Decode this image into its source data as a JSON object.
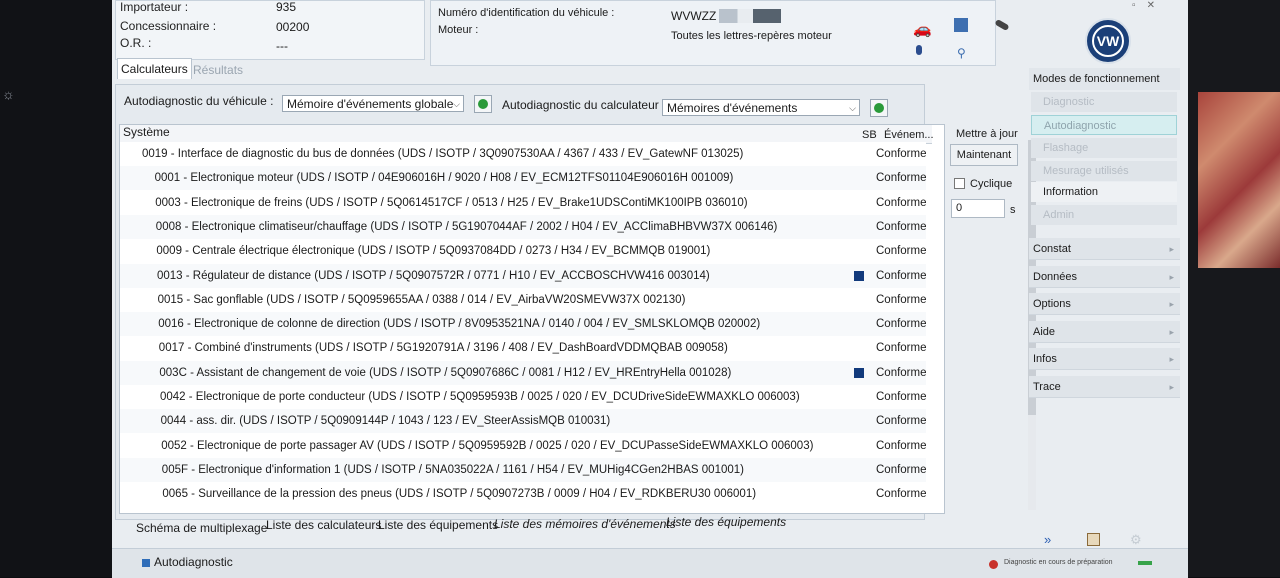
{
  "header": {
    "importer_label": "Importateur :",
    "importer_value": "935",
    "dealer_label": "Concessionnaire :",
    "dealer_value": "00200",
    "or_label": "O.R. :",
    "or_value": "---",
    "vin_label": "Numéro d'identification du véhicule :",
    "vin_value": "WVWZZ",
    "engine_label": "Moteur :",
    "engine_value": "Toutes les lettres-repères moteur"
  },
  "tabs": [
    {
      "label": "Calculateurs"
    },
    {
      "label": "Résultats"
    }
  ],
  "toolbar": {
    "vehicle_diag_label": "Autodiagnostic du véhicule :",
    "vehicle_diag_value": "Mémoire d'événements globale",
    "ecu_diag_label": "Autodiagnostic du calculateur :",
    "ecu_diag_value": "Mémoires d'événements"
  },
  "grid": {
    "col_system": "Système",
    "col_sb": "SB",
    "col_event": "Événem..."
  },
  "rows": [
    {
      "system": "0019 - Interface de diagnostic du bus de données  (UDS / ISOTP / 3Q0907530AA / 4367 / 433 / EV_GatewNF 013025)",
      "result": "Conforme",
      "flag": false
    },
    {
      "system": "0001 - Electronique moteur  (UDS / ISOTP / 04E906016H / 9020 / H08 / EV_ECM12TFS01104E906016H 001009)",
      "result": "Conforme",
      "flag": false
    },
    {
      "system": "0003 - Electronique de freins  (UDS / ISOTP / 5Q0614517CF / 0513 / H25 / EV_Brake1UDSContiMK100IPB 036010)",
      "result": "Conforme",
      "flag": false
    },
    {
      "system": "0008 - Electronique climatiseur/chauffage  (UDS / ISOTP / 5G1907044AF / 2002 / H04 / EV_ACClimaBHBVW37X 006146)",
      "result": "Conforme",
      "flag": false
    },
    {
      "system": "0009 - Centrale électrique électronique  (UDS / ISOTP / 5Q0937084DD / 0273 / H34 / EV_BCMMQB 019001)",
      "result": "Conforme",
      "flag": false
    },
    {
      "system": "0013 - Régulateur de distance  (UDS / ISOTP / 5Q0907572R / 0771 / H10 / EV_ACCBOSCHVW416 003014)",
      "result": "Conforme",
      "flag": true
    },
    {
      "system": "0015 - Sac gonflable  (UDS / ISOTP / 5Q0959655AA / 0388 / 014 / EV_AirbaVW20SMEVW37X 002130)",
      "result": "Conforme",
      "flag": false
    },
    {
      "system": "0016 - Electronique de colonne de direction  (UDS / ISOTP / 8V0953521NA / 0140 / 004 / EV_SMLSKLOMQB 020002)",
      "result": "Conforme",
      "flag": false
    },
    {
      "system": "0017 - Combiné d'instruments  (UDS / ISOTP / 5G1920791A / 3196 / 408 / EV_DashBoardVDDMQBAB 009058)",
      "result": "Conforme",
      "flag": false
    },
    {
      "system": "003C - Assistant de changement de voie  (UDS / ISOTP / 5Q0907686C / 0081 / H12 / EV_HREntryHella 001028)",
      "result": "Conforme",
      "flag": true
    },
    {
      "system": "0042 - Electronique de porte conducteur  (UDS / ISOTP / 5Q0959593B / 0025 / 020 / EV_DCUDriveSideEWMAXKLO 006003)",
      "result": "Conforme",
      "flag": false
    },
    {
      "system": "0044 - ass. dir.  (UDS / ISOTP / 5Q0909144P / 1043 / 123 / EV_SteerAssisMQB 010031)",
      "result": "Conforme",
      "flag": false
    },
    {
      "system": "0052 - Electronique de porte passager AV  (UDS / ISOTP / 5Q0959592B / 0025 / 020 / EV_DCUPasseSideEWMAXKLO 006003)",
      "result": "Conforme",
      "flag": false
    },
    {
      "system": "005F - Electronique d'information 1  (UDS / ISOTP / 5NA035022A / 1161 / H54 / EV_MUHig4CGen2HBAS 001001)",
      "result": "Conforme",
      "flag": false
    },
    {
      "system": "0065 - Surveillance de la pression des pneus  (UDS / ISOTP / 5Q0907273B / 0009 / H04 / EV_RDKBERU30 006001)",
      "result": "Conforme",
      "flag": false
    }
  ],
  "update": {
    "label": "Mettre à jour",
    "now_button": "Maintenant",
    "cyclic_label": "Cyclique",
    "interval_value": "0",
    "interval_unit": "s"
  },
  "modes": {
    "title": "Modes de fonctionnement",
    "items": [
      {
        "label": "Diagnostic"
      },
      {
        "label": "Autodiagnostic"
      },
      {
        "label": "Flashage"
      },
      {
        "label": "Mesurage utilisés"
      },
      {
        "label": "Information"
      },
      {
        "label": "Admin"
      }
    ]
  },
  "menu": [
    {
      "label": "Constat"
    },
    {
      "label": "Données"
    },
    {
      "label": "Options"
    },
    {
      "label": "Aide"
    },
    {
      "label": "Infos"
    },
    {
      "label": "Trace"
    }
  ],
  "bottom_tabs": [
    {
      "label": "Schéma de multiplexage"
    },
    {
      "label": "Liste des calculateurs"
    },
    {
      "label": "Liste des équipements"
    },
    {
      "label": "Liste des mémoires d'événements"
    },
    {
      "label": "Liste des équipements"
    }
  ],
  "status": {
    "mode": "Autodiagnostic",
    "message": "Diagnostic en cours de préparation"
  },
  "colors": {
    "accent_green": "#2a9a3a",
    "flag_blue": "#123a7c",
    "status_red": "#c8322b"
  }
}
